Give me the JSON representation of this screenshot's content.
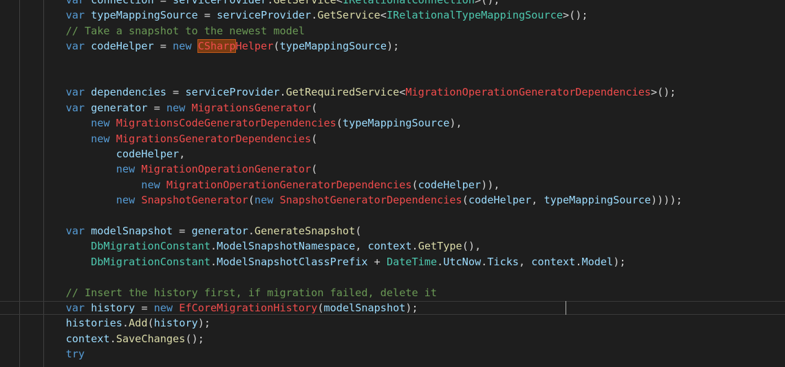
{
  "colors": {
    "background": "#1e1e1e",
    "keyword": "#569cd6",
    "variable": "#9cdcfe",
    "method": "#dcdcaa",
    "type": "#4ec9b0",
    "error_type": "#f14c4c",
    "comment": "#6a9955",
    "punctuation": "#d4d4d4"
  },
  "editor": {
    "lines": [
      [
        [
          "k",
          "    var "
        ],
        [
          "v",
          "connection"
        ],
        [
          "p",
          " = "
        ],
        [
          "v",
          "serviceProvider"
        ],
        [
          "p",
          "."
        ],
        [
          "m",
          "GetService"
        ],
        [
          "p",
          "<"
        ],
        [
          "t",
          "IRelationalConnection"
        ],
        [
          "p",
          ">();"
        ]
      ],
      [
        [
          "k",
          "    var "
        ],
        [
          "v",
          "typeMappingSource"
        ],
        [
          "p",
          " = "
        ],
        [
          "v",
          "serviceProvider"
        ],
        [
          "p",
          "."
        ],
        [
          "m",
          "GetService"
        ],
        [
          "p",
          "<"
        ],
        [
          "t",
          "IRelationalTypeMappingSource"
        ],
        [
          "p",
          ">();"
        ]
      ],
      [
        [
          "c",
          "    // Take a snapshot to the newest model"
        ]
      ],
      [
        [
          "k",
          "    var "
        ],
        [
          "v",
          "codeHelper"
        ],
        [
          "p",
          " = "
        ],
        [
          "k",
          "new "
        ],
        [
          "hl",
          "CSharp"
        ],
        [
          "e",
          "Helper"
        ],
        [
          "p",
          "("
        ],
        [
          "v",
          "typeMappingSource"
        ],
        [
          "p",
          ");"
        ]
      ],
      [],
      [],
      [
        [
          "k",
          "    var "
        ],
        [
          "v",
          "dependencies"
        ],
        [
          "p",
          " = "
        ],
        [
          "v",
          "serviceProvider"
        ],
        [
          "p",
          "."
        ],
        [
          "m",
          "GetRequiredService"
        ],
        [
          "p",
          "<"
        ],
        [
          "e",
          "MigrationOperationGeneratorDependencies"
        ],
        [
          "p",
          ">();"
        ]
      ],
      [
        [
          "k",
          "    var "
        ],
        [
          "v",
          "generator"
        ],
        [
          "p",
          " = "
        ],
        [
          "k",
          "new "
        ],
        [
          "e",
          "MigrationsGenerator"
        ],
        [
          "p",
          "("
        ]
      ],
      [
        [
          "k",
          "        new "
        ],
        [
          "e",
          "MigrationsCodeGeneratorDependencies"
        ],
        [
          "p",
          "("
        ],
        [
          "v",
          "typeMappingSource"
        ],
        [
          "p",
          "),"
        ]
      ],
      [
        [
          "k",
          "        new "
        ],
        [
          "e",
          "MigrationsGeneratorDependencies"
        ],
        [
          "p",
          "("
        ]
      ],
      [
        [
          "v",
          "            codeHelper"
        ],
        [
          "p",
          ","
        ]
      ],
      [
        [
          "k",
          "            new "
        ],
        [
          "e",
          "MigrationOperationGenerator"
        ],
        [
          "p",
          "("
        ]
      ],
      [
        [
          "k",
          "                new "
        ],
        [
          "e",
          "MigrationOperationGeneratorDependencies"
        ],
        [
          "p",
          "("
        ],
        [
          "v",
          "codeHelper"
        ],
        [
          "p",
          ")),"
        ]
      ],
      [
        [
          "k",
          "            new "
        ],
        [
          "e",
          "SnapshotGenerator"
        ],
        [
          "p",
          "("
        ],
        [
          "k",
          "new "
        ],
        [
          "e",
          "SnapshotGeneratorDependencies"
        ],
        [
          "p",
          "("
        ],
        [
          "v",
          "codeHelper"
        ],
        [
          "p",
          ", "
        ],
        [
          "v",
          "typeMappingSource"
        ],
        [
          "p",
          "))));"
        ]
      ],
      [],
      [
        [
          "k",
          "    var "
        ],
        [
          "v",
          "modelSnapshot"
        ],
        [
          "p",
          " = "
        ],
        [
          "v",
          "generator"
        ],
        [
          "p",
          "."
        ],
        [
          "m",
          "GenerateSnapshot"
        ],
        [
          "p",
          "("
        ]
      ],
      [
        [
          "t",
          "        DbMigrationConstant"
        ],
        [
          "p",
          "."
        ],
        [
          "v",
          "ModelSnapshotNamespace"
        ],
        [
          "p",
          ", "
        ],
        [
          "v",
          "context"
        ],
        [
          "p",
          "."
        ],
        [
          "m",
          "GetType"
        ],
        [
          "p",
          "(),"
        ]
      ],
      [
        [
          "t",
          "        DbMigrationConstant"
        ],
        [
          "p",
          "."
        ],
        [
          "v",
          "ModelSnapshotClassPrefix"
        ],
        [
          "p",
          " + "
        ],
        [
          "t",
          "DateTime"
        ],
        [
          "p",
          "."
        ],
        [
          "v",
          "UtcNow"
        ],
        [
          "p",
          "."
        ],
        [
          "v",
          "Ticks"
        ],
        [
          "p",
          ", "
        ],
        [
          "v",
          "context"
        ],
        [
          "p",
          "."
        ],
        [
          "v",
          "Model"
        ],
        [
          "p",
          ");"
        ]
      ],
      [],
      [
        [
          "c",
          "    // Insert the history first, if migration failed, delete it"
        ]
      ],
      [
        [
          "k",
          "    var "
        ],
        [
          "v",
          "history"
        ],
        [
          "p",
          " = "
        ],
        [
          "k",
          "new "
        ],
        [
          "e",
          "EfCoreMigrationHistory"
        ],
        [
          "p",
          "("
        ],
        [
          "v",
          "modelSnapshot"
        ],
        [
          "p",
          ");"
        ]
      ],
      [
        [
          "v",
          "    histories"
        ],
        [
          "p",
          "."
        ],
        [
          "m",
          "Add"
        ],
        [
          "p",
          "("
        ],
        [
          "v",
          "history"
        ],
        [
          "p",
          ");"
        ]
      ],
      [
        [
          "v",
          "    context"
        ],
        [
          "p",
          "."
        ],
        [
          "m",
          "SaveChanges"
        ],
        [
          "p",
          "();"
        ]
      ],
      [
        [
          "k",
          "    try"
        ]
      ]
    ]
  }
}
